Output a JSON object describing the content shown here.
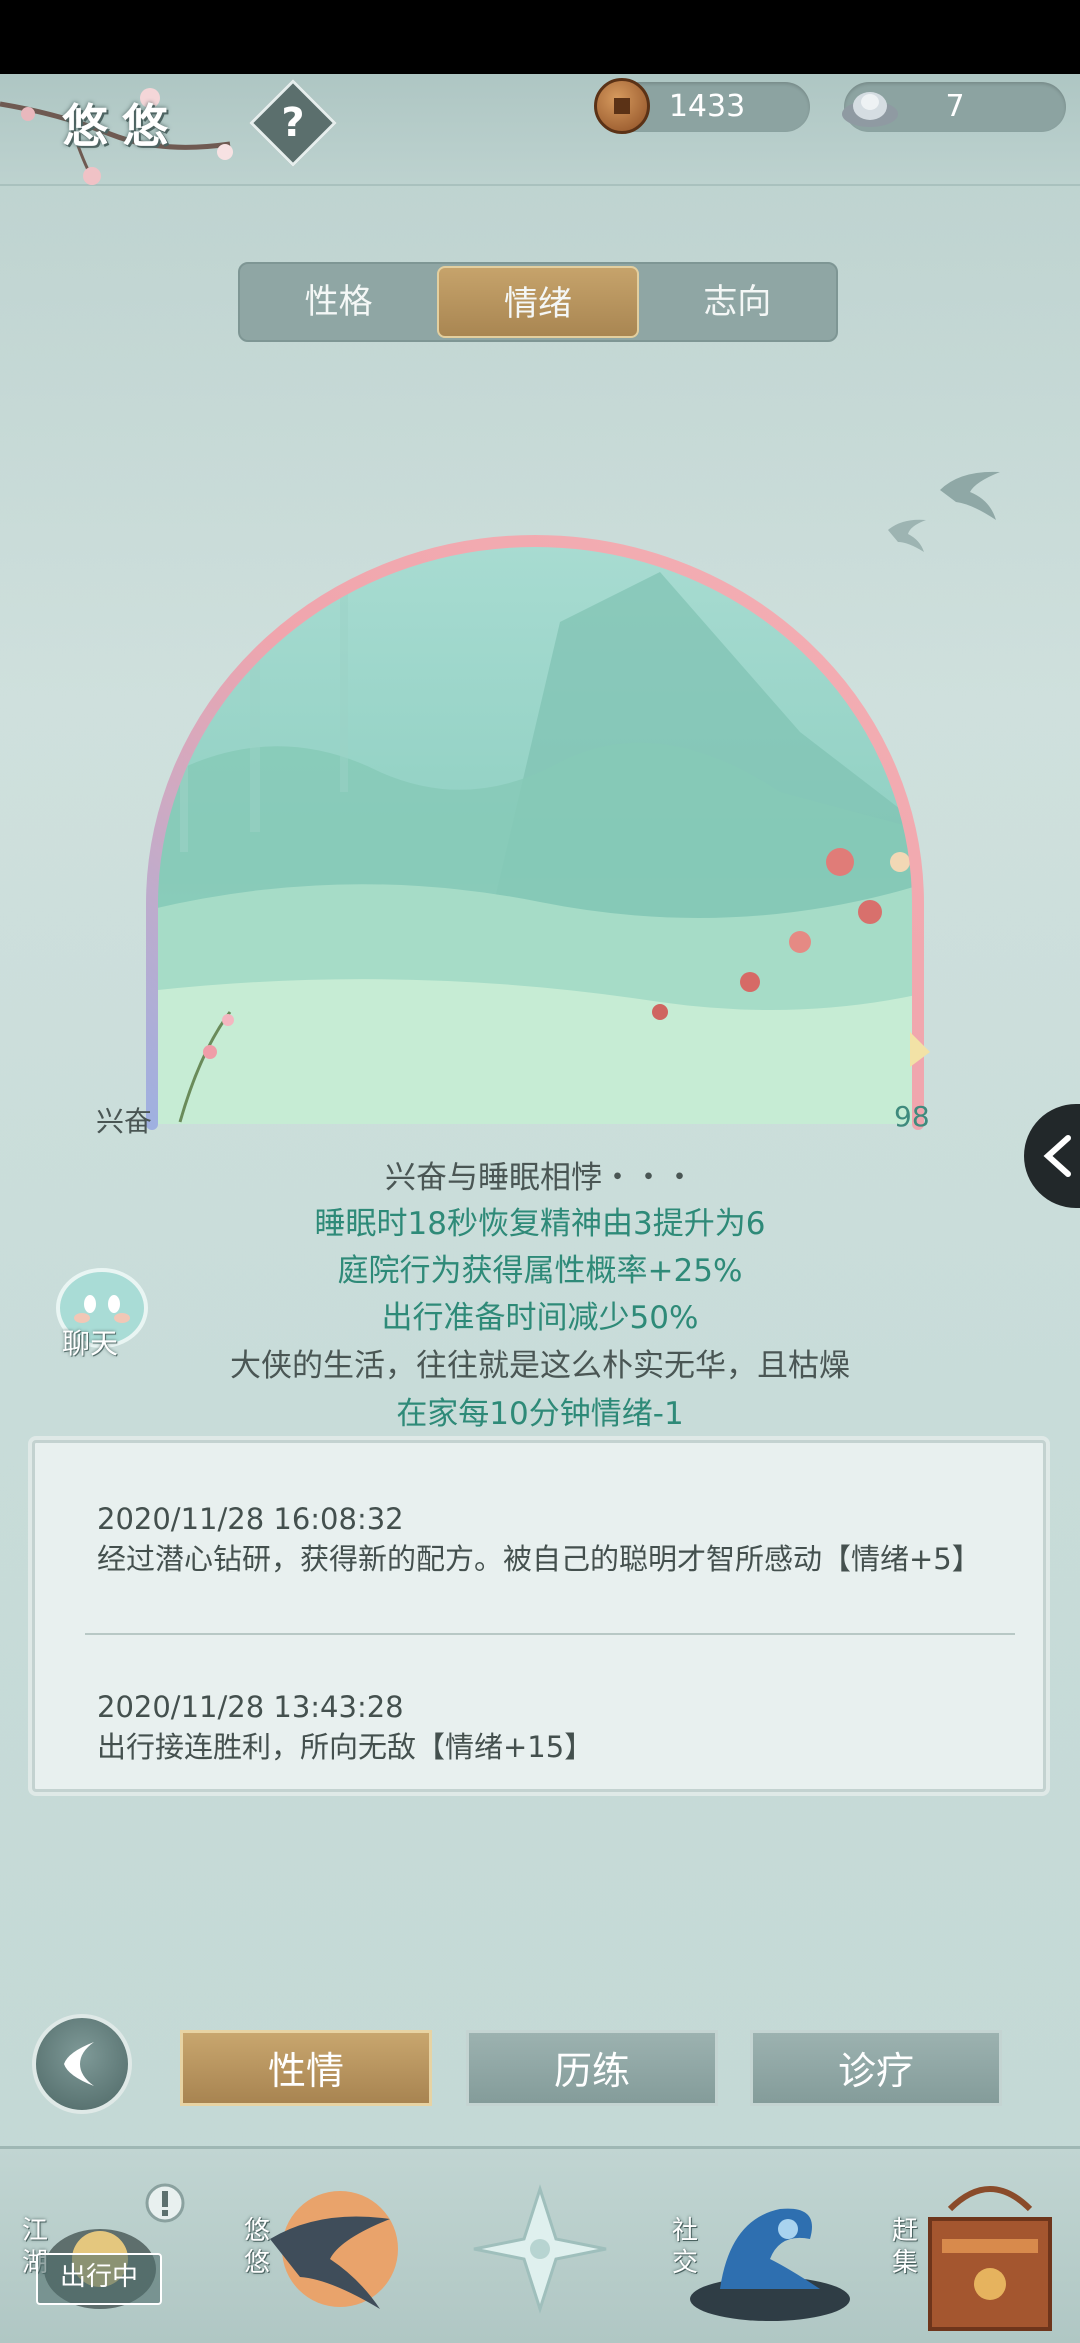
{
  "header": {
    "title": "悠悠",
    "help_label": "?",
    "copper_coins": "1433",
    "silver_ingots": "7"
  },
  "tabs": [
    {
      "label": "性格",
      "active": false
    },
    {
      "label": "情绪",
      "active": true
    },
    {
      "label": "志向",
      "active": false
    }
  ],
  "mood": {
    "name_label": "兴奋",
    "value": "98",
    "level": 98,
    "title_line": "兴奋与睡眠相悖・・・",
    "effects": [
      "睡眠时18秒恢复精神由3提升为6",
      "庭院行为获得属性概率+25%",
      "出行准备时间减少50%"
    ],
    "flavor": "大侠的生活，往往就是这么朴实无华，且枯燥",
    "decay": "在家每10分钟情绪-1"
  },
  "chat": {
    "label": "聊天"
  },
  "log": [
    {
      "time": "2020/11/28  16:08:32",
      "text": "经过潜心钻研，获得新的配方。被自己的聪明才智所感动【情绪+5】"
    },
    {
      "time": "2020/11/28  13:43:28",
      "text": "出行接连胜利，所向无敌【情绪+15】"
    }
  ],
  "bottom_buttons": {
    "temperament": "性情",
    "experience": "历练",
    "treatment": "诊疗"
  },
  "nav": {
    "jianghu": "江湖",
    "jianghu_badge": "出行中",
    "youyou": "悠悠",
    "shejiao": "社交",
    "ganji": "赶集"
  },
  "colors": {
    "accent_gold": "#b8955e",
    "accent_green": "#2e8a78",
    "mood_ring_pink": "#f0a5ad",
    "mood_ring_blue": "#9fb0e0"
  }
}
